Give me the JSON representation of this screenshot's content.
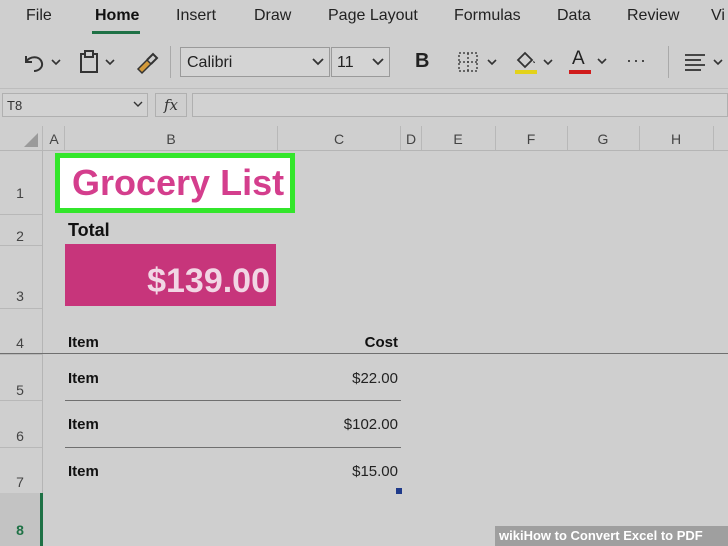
{
  "ribbon": {
    "tabs": [
      {
        "label": "File"
      },
      {
        "label": "Home"
      },
      {
        "label": "Insert"
      },
      {
        "label": "Draw"
      },
      {
        "label": "Page Layout"
      },
      {
        "label": "Formulas"
      },
      {
        "label": "Data"
      },
      {
        "label": "Review"
      },
      {
        "label": "Vi"
      }
    ],
    "active_tab": "Home"
  },
  "toolbar": {
    "font_name": "Calibri",
    "font_size": "11",
    "bold_label": "B",
    "font_color_label": "A",
    "more_label": "···",
    "highlight_color": "#e3d21a",
    "font_color": "#d01b1b"
  },
  "formula_bar": {
    "name_box": "T8",
    "fx_label": "fx",
    "value": ""
  },
  "columns": [
    "A",
    "B",
    "C",
    "D",
    "E",
    "F",
    "G",
    "H"
  ],
  "rows": [
    "1",
    "2",
    "3",
    "4",
    "5",
    "6",
    "7",
    "8"
  ],
  "sheet": {
    "title": "Grocery List",
    "total_label": "Total",
    "total_value": "$139.00",
    "header_item": "Item",
    "header_cost": "Cost",
    "items": [
      {
        "name": "Item",
        "cost": "$22.00"
      },
      {
        "name": "Item",
        "cost": "$102.00"
      },
      {
        "name": "Item",
        "cost": "$15.00"
      }
    ]
  },
  "watermark": {
    "brand": "wiki",
    "text": "How to Convert Excel to PDF"
  },
  "colors": {
    "accent_green": "#1e7145",
    "title_pink": "#d43e8d",
    "total_fill": "#c7357b",
    "selection_green": "#33e62b"
  }
}
